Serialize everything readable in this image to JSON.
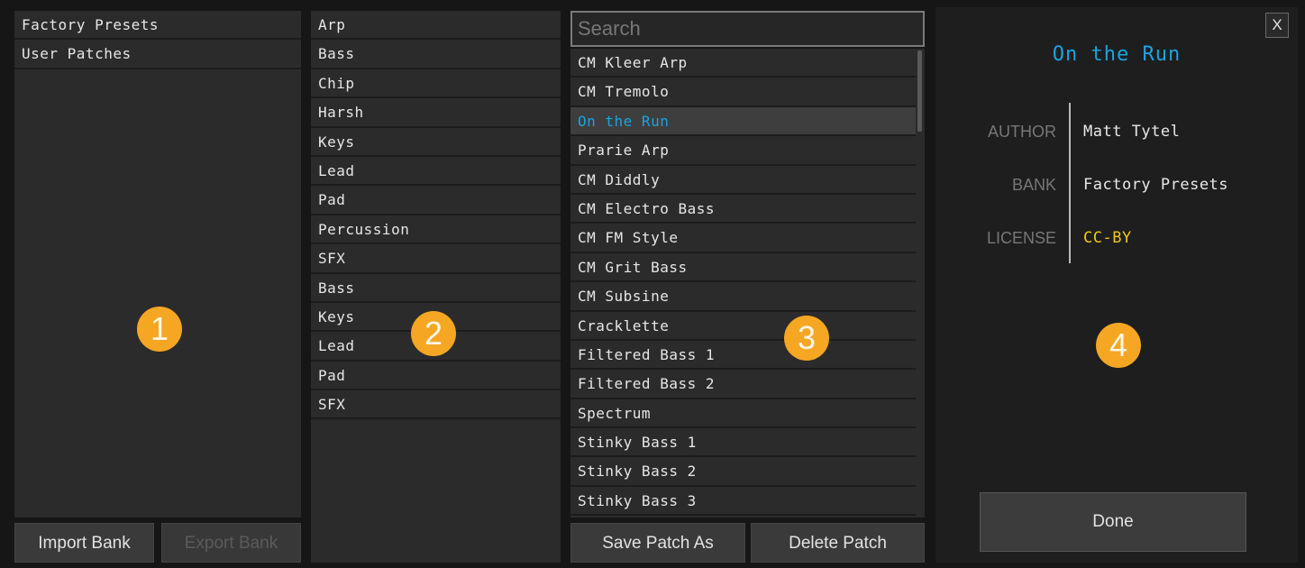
{
  "banks": {
    "items": [
      "Factory Presets",
      "User Patches"
    ],
    "import_label": "Import Bank",
    "export_label": "Export Bank"
  },
  "folders": {
    "items": [
      "Arp",
      "Bass",
      "Chip",
      "Harsh",
      "Keys",
      "Lead",
      "Pad",
      "Percussion",
      "SFX",
      "Bass",
      "Keys",
      "Lead",
      "Pad",
      "SFX"
    ]
  },
  "patches": {
    "search_placeholder": "Search",
    "items": [
      "CM Kleer Arp",
      "CM Tremolo",
      "On the Run",
      "Prarie Arp",
      "CM Diddly",
      "CM Electro Bass",
      "CM FM Style",
      "CM Grit Bass",
      "CM Subsine",
      "Cracklette",
      "Filtered Bass 1",
      "Filtered Bass 2",
      "Spectrum",
      "Stinky Bass 1",
      "Stinky Bass 2",
      "Stinky Bass 3"
    ],
    "selected_index": 2,
    "save_label": "Save Patch As",
    "delete_label": "Delete Patch"
  },
  "details": {
    "close_label": "X",
    "patch_name": "On the Run",
    "author_label": "AUTHOR",
    "author_value": "Matt Tytel",
    "bank_label": "BANK",
    "bank_value": "Factory Presets",
    "license_label": "LICENSE",
    "license_value": "CC-BY",
    "done_label": "Done"
  },
  "markers": [
    "1",
    "2",
    "3",
    "4"
  ],
  "colors": {
    "accent_blue": "#1ba3e0",
    "license_yellow": "#f5c518",
    "marker_orange": "#f5a623",
    "panel": "#2b2b2b",
    "background": "#161616"
  }
}
